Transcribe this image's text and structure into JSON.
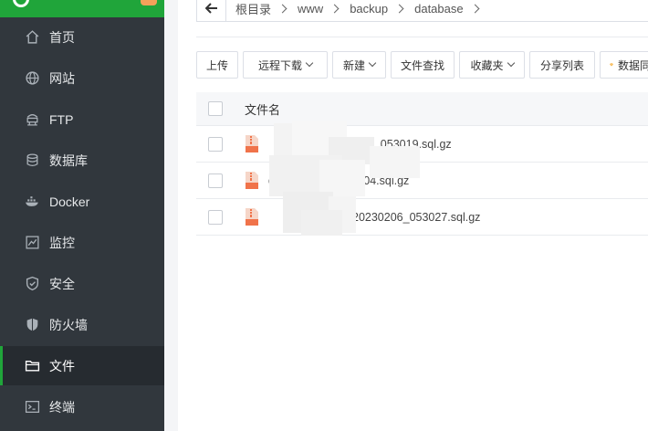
{
  "sidebar": {
    "items": [
      {
        "label": "首页",
        "icon": "home-icon"
      },
      {
        "label": "网站",
        "icon": "globe-icon"
      },
      {
        "label": "FTP",
        "icon": "ftp-icon"
      },
      {
        "label": "数据库",
        "icon": "database-icon"
      },
      {
        "label": "Docker",
        "icon": "docker-icon"
      },
      {
        "label": "监控",
        "icon": "monitor-icon"
      },
      {
        "label": "安全",
        "icon": "shield-icon"
      },
      {
        "label": "防火墙",
        "icon": "firewall-icon"
      },
      {
        "label": "文件",
        "icon": "folder-icon",
        "active": true
      },
      {
        "label": "终端",
        "icon": "terminal-icon"
      }
    ]
  },
  "breadcrumb": [
    "根目录",
    "www",
    "backup",
    "database"
  ],
  "toolbar": {
    "upload": "上传",
    "remote_download": "远程下载",
    "new": "新建",
    "file_search": "文件查找",
    "favorites": "收藏夹",
    "share_list": "分享列表",
    "database": "数据同"
  },
  "table": {
    "header": "文件名",
    "rows": [
      {
        "name": "206_053019.sql.gz"
      },
      {
        "name": "d_20230206_053004.sql.gz"
      },
      {
        "name": "20230206_053027.sql.gz"
      }
    ]
  },
  "colors": {
    "brand": "#20a53a",
    "sidebar_bg": "#31373d",
    "file_icon": "#f0734a"
  }
}
